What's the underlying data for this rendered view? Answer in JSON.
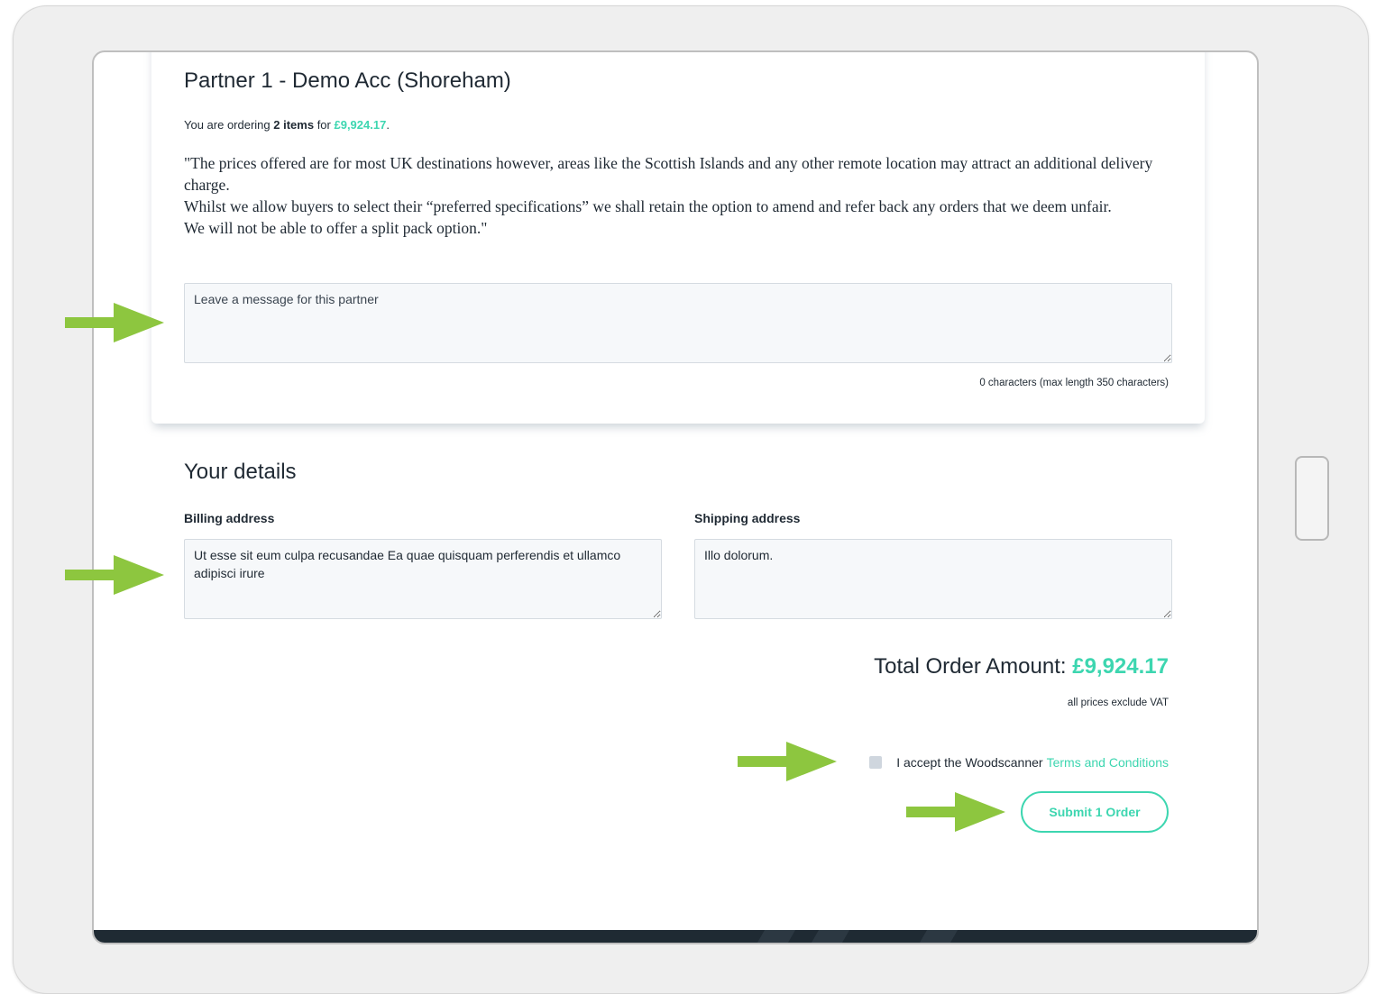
{
  "partner": {
    "title": "Partner 1 - Demo Acc (Shoreham)",
    "ordering_prefix": "You are ordering ",
    "items_text": "2 items",
    "for_text": " for ",
    "amount": "£9,924.17",
    "period": ".",
    "notice_lines": [
      "\"The prices offered are for most UK destinations however, areas like the Scottish Islands and any other remote location may attract an additional delivery charge.",
      "Whilst we allow buyers to select their “preferred specifications” we shall retain the option to amend and refer back any orders that we deem unfair.",
      "We will not be able to offer a split pack option.\""
    ],
    "message_placeholder": "Leave a message for this partner",
    "message_value": "",
    "char_count_text": "0 characters (max length 350 characters)"
  },
  "details": {
    "title": "Your details",
    "billing_label": "Billing address",
    "billing_value": "Ut esse sit eum culpa recusandae Ea quae quisquam perferendis et ullamco adipisci irure",
    "shipping_label": "Shipping address",
    "shipping_value": "Illo dolorum."
  },
  "summary": {
    "total_label": "Total Order Amount: ",
    "total_value": "£9,924.17",
    "vat_note": "all prices exclude VAT",
    "terms_prefix": "I accept the Woodscanner",
    "terms_link": "Terms and Conditions",
    "terms_checked": false,
    "submit_label": "Submit 1 Order"
  },
  "colors": {
    "accent": "#3dd6b0",
    "annotation_arrow": "#8dc63f",
    "footer": "#1f2a33"
  },
  "icons": {
    "annotation": "arrow-right-icon"
  }
}
